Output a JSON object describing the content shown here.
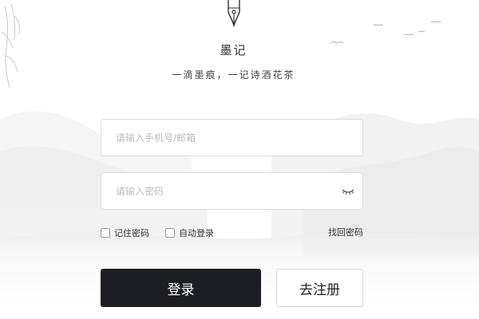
{
  "brand": {
    "title": "墨记",
    "subtitle": "一滴墨痕，一记诗酒花茶"
  },
  "form": {
    "phone_placeholder": "请输入手机号/邮箱",
    "password_placeholder": "请输入密码",
    "remember_label": "记住密码",
    "autologin_label": "自动登录",
    "forgot_label": "找回密码",
    "login_label": "登录",
    "register_label": "去注册"
  },
  "icons": {
    "logo": "fountain-pen-nib-icon",
    "password_toggle": "eye-closed-icon"
  },
  "colors": {
    "primary_button": "#1d1e24",
    "text": "#333333",
    "border": "#dcdcdc"
  }
}
